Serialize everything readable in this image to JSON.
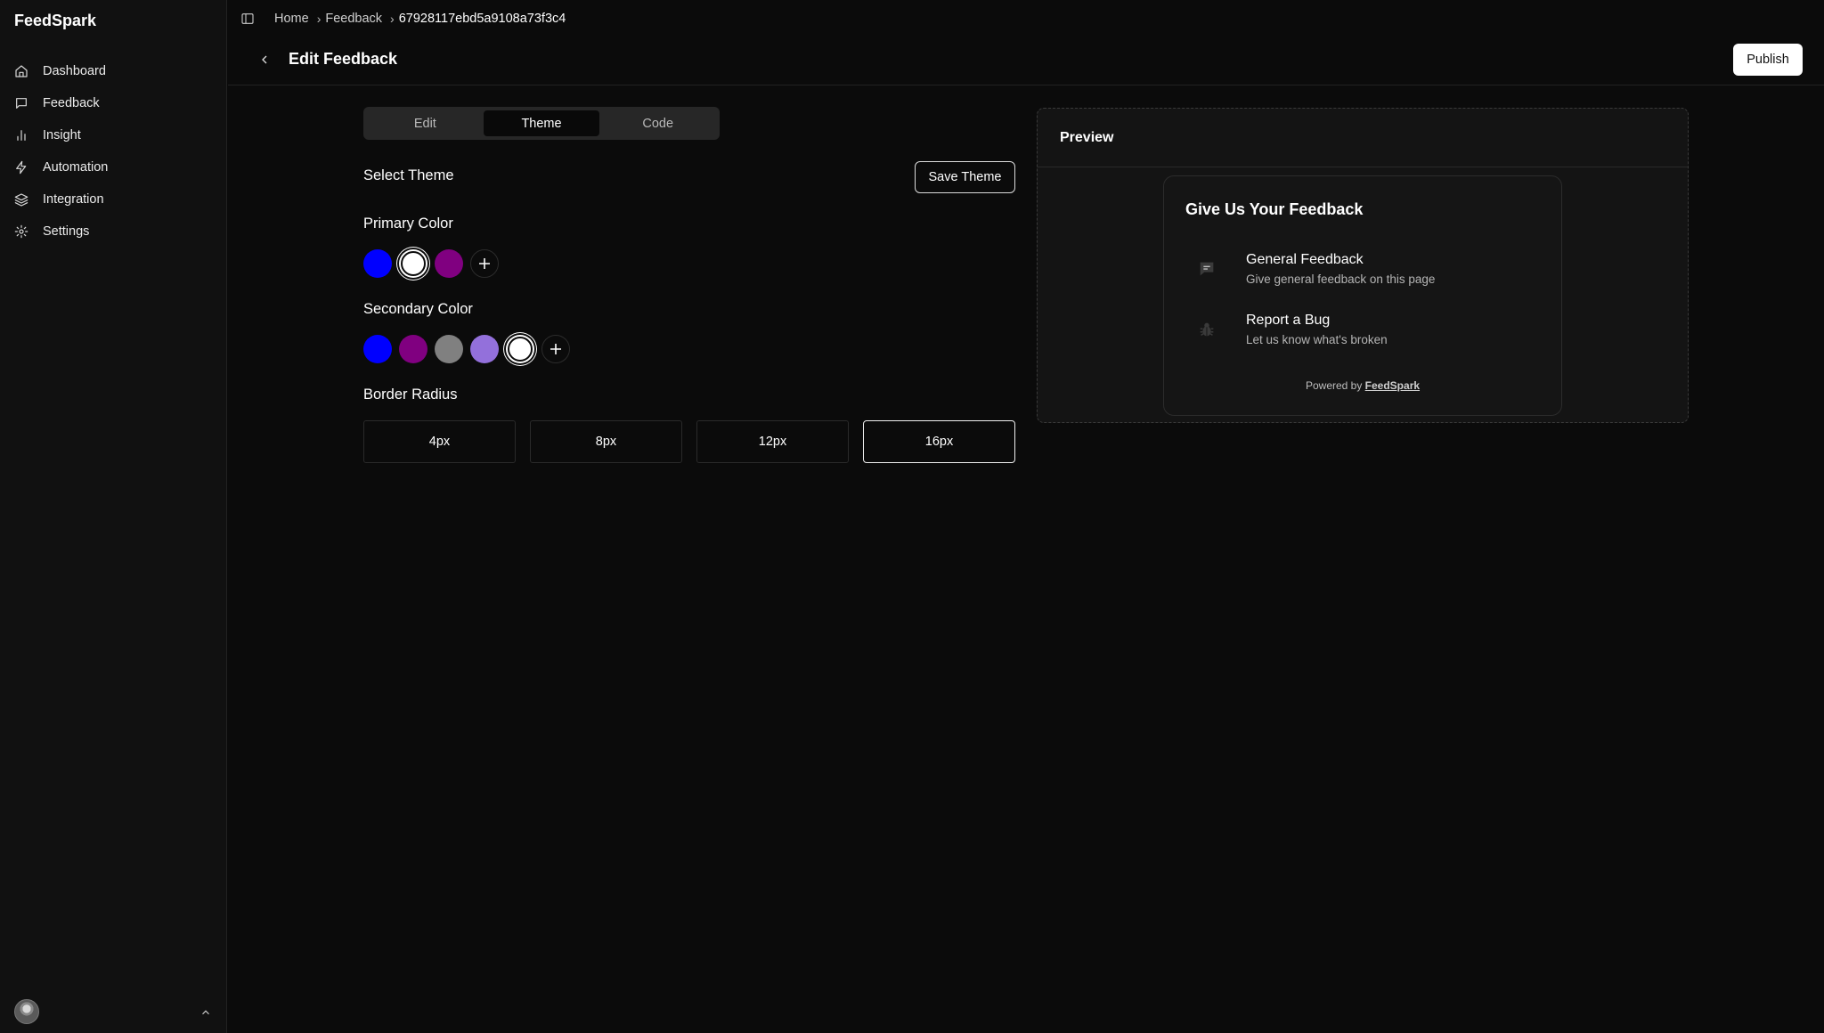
{
  "app": {
    "name": "FeedSpark"
  },
  "sidebar": {
    "items": [
      {
        "label": "Dashboard",
        "icon": "home-icon"
      },
      {
        "label": "Feedback",
        "icon": "message-square-icon"
      },
      {
        "label": "Insight",
        "icon": "bar-chart-icon"
      },
      {
        "label": "Automation",
        "icon": "zap-icon"
      },
      {
        "label": "Integration",
        "icon": "layers-icon"
      },
      {
        "label": "Settings",
        "icon": "gear-icon"
      }
    ]
  },
  "breadcrumb": {
    "home": "Home",
    "feedback": "Feedback",
    "current": "67928117ebd5a9108a73f3c4"
  },
  "header": {
    "title": "Edit Feedback",
    "publish_label": "Publish"
  },
  "tabs": {
    "edit": "Edit",
    "theme": "Theme",
    "code": "Code",
    "active": "Theme"
  },
  "theme": {
    "select_label": "Select Theme",
    "save_label": "Save Theme",
    "primary_label": "Primary Color",
    "primary_colors": [
      "#0000ff",
      "#ffffff",
      "#800080"
    ],
    "primary_selected": "#ffffff",
    "secondary_label": "Secondary Color",
    "secondary_colors": [
      "#0000ff",
      "#800080",
      "#808080",
      "#9370db",
      "#ffffff"
    ],
    "secondary_selected": "#ffffff",
    "radius_label": "Border Radius",
    "radius_options": [
      "4px",
      "8px",
      "12px",
      "16px"
    ],
    "radius_selected": "16px"
  },
  "preview": {
    "title": "Preview",
    "widget_title": "Give Us Your Feedback",
    "options": [
      {
        "title": "General Feedback",
        "description": "Give general feedback on this page",
        "icon": "chat-bubble-icon"
      },
      {
        "title": "Report a Bug",
        "description": "Let us know what's broken",
        "icon": "bug-icon"
      }
    ],
    "powered_prefix": "Powered by",
    "powered_brand": "FeedSpark"
  }
}
